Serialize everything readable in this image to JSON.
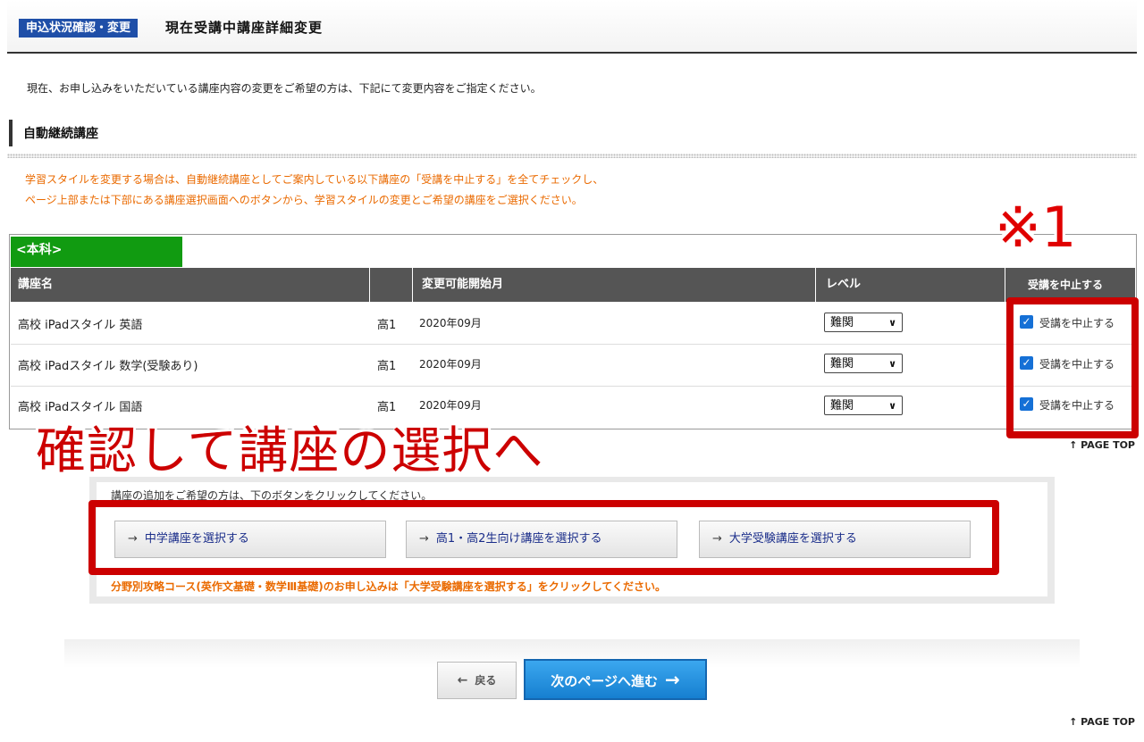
{
  "header": {
    "badge": "申込状況確認・変更",
    "title": "現在受講中講座詳細変更"
  },
  "intro_text": "現在、お申し込みをいただいている講座内容の変更をご希望の方は、下記にて変更内容をご指定ください。",
  "section": {
    "title": "自動継続講座",
    "note_line1": "学習スタイルを変更する場合は、自動継続講座としてご案内している以下講座の「受講を中止する」を全てチェックし、",
    "note_line2": "ページ上部または下部にある講座選択画面へのボタンから、学習スタイルの変更とご希望の講座をご選択ください。"
  },
  "table": {
    "group_tab": "<本科>",
    "headers": {
      "name": "講座名",
      "start": "変更可能開始月",
      "level": "レベル",
      "stop": "受講を中止する"
    },
    "rows": [
      {
        "name": "高校 iPadスタイル 英語",
        "grade": "高1",
        "start": "2020年09月",
        "level": "難関",
        "stop_label": "受講を中止する",
        "checked": true
      },
      {
        "name": "高校 iPadスタイル 数学(受験あり)",
        "grade": "高1",
        "start": "2020年09月",
        "level": "難関",
        "stop_label": "受講を中止する",
        "checked": true
      },
      {
        "name": "高校 iPadスタイル 国語",
        "grade": "高1",
        "start": "2020年09月",
        "level": "難関",
        "stop_label": "受講を中止する",
        "checked": true
      }
    ]
  },
  "annotations": {
    "mark": "※1",
    "big": "確認して講座の選択へ",
    "color": "#cc0000"
  },
  "page_top": "↑ PAGE TOP",
  "course_select": {
    "caption": "講座の追加をご希望の方は、下のボタンをクリックしてください。",
    "buttons": [
      "中学講座を選択する",
      "高1・高2生向け講座を選択する",
      "大学受験講座を選択する"
    ],
    "note": "分野別攻略コース(英作文基礎・数学Ⅲ基礎)のお申し込みは「大学受験講座を選択する」をクリックしてください。"
  },
  "nav": {
    "back": "戻る",
    "next": "次のページへ進む"
  },
  "colors": {
    "badge": "#1f4fa8",
    "tab_green": "#119b11",
    "table_header": "#555555",
    "note_orange": "#ea6a00",
    "checkbox": "#1570d6",
    "next_button": "#1a8ee0"
  }
}
